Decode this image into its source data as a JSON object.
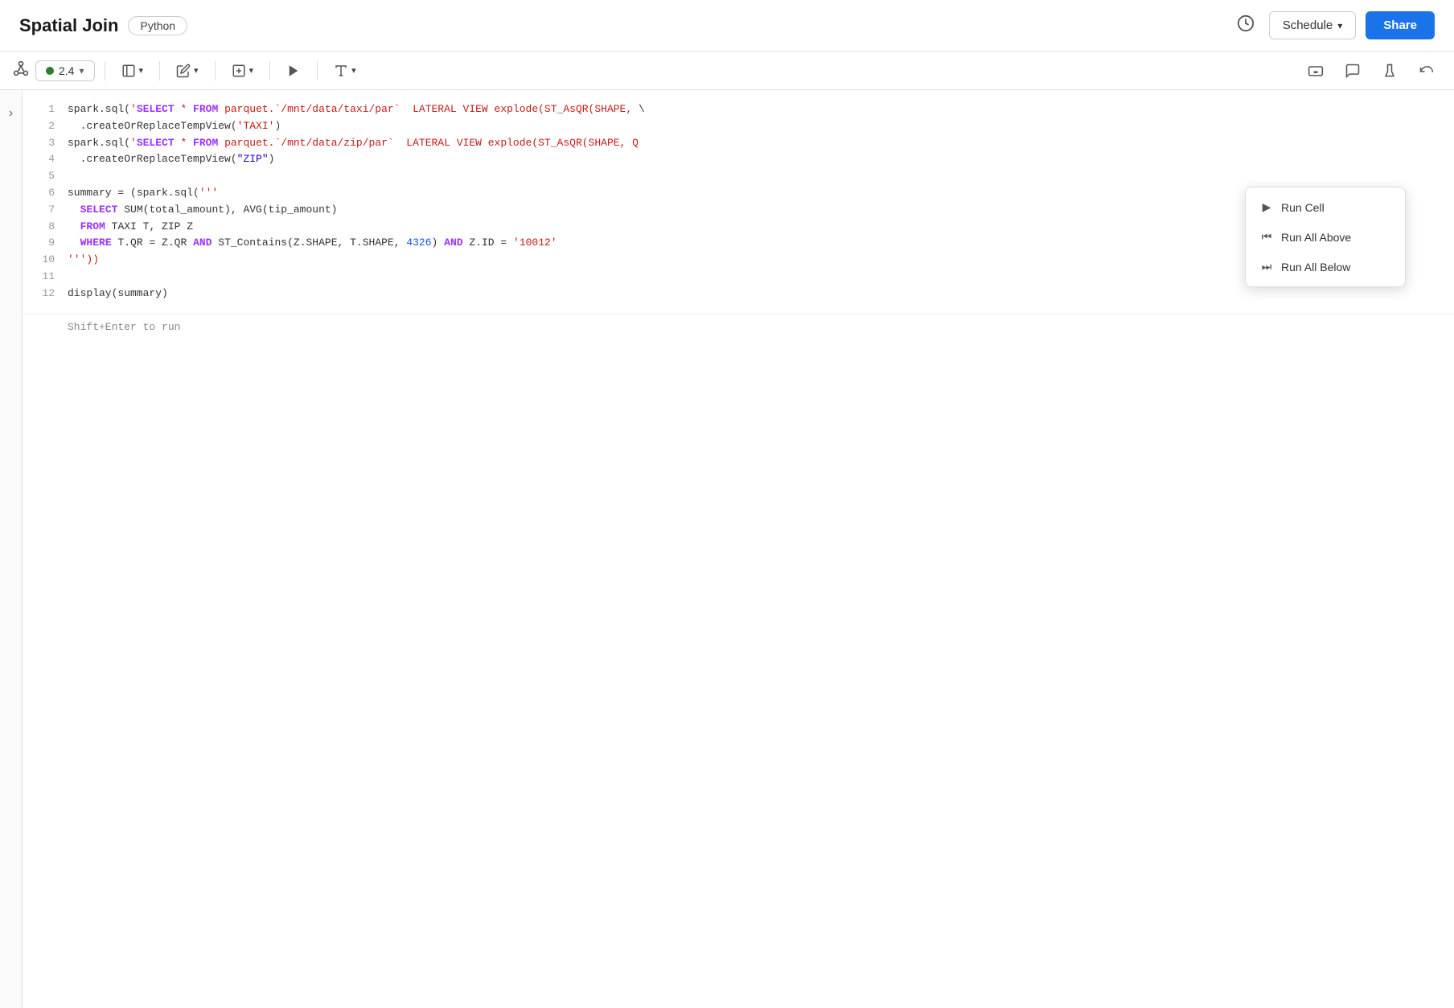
{
  "header": {
    "title": "Spatial Join",
    "language_badge": "Python",
    "schedule_label": "Schedule",
    "share_label": "Share"
  },
  "toolbar": {
    "cluster_version": "2.4",
    "buttons": {
      "notebook_menu": "≡",
      "edit": "✎",
      "insert": "⊞",
      "run": "▶",
      "run_dropdown": "▾",
      "keyboard": "⌨",
      "comment": "💬",
      "experiment": "⚗",
      "history": "↺"
    }
  },
  "sidebar": {
    "toggle_icon": "›"
  },
  "code_lines": [
    {
      "number": 1,
      "content": "spark.sql('SELECT * FROM parquet.`/mnt/data/taxi/par` LATERAL VIEW explode(ST_AsQR(SHAPE, \\"
    },
    {
      "number": 2,
      "content": ".createOrReplaceTempView('TAXI')"
    },
    {
      "number": 3,
      "content": "spark.sql('SELECT * FROM parquet.`/mnt/data/zip/par` LATERAL VIEW explode(ST_AsQR(SHAPE, Q"
    },
    {
      "number": 4,
      "content": ".createOrReplaceTempView(\"ZIP\")"
    },
    {
      "number": 5,
      "content": ""
    },
    {
      "number": 6,
      "content": "summary = (spark.sql('''"
    },
    {
      "number": 7,
      "content": "  SELECT SUM(total_amount), AVG(tip_amount)"
    },
    {
      "number": 8,
      "content": "  FROM TAXI T, ZIP Z"
    },
    {
      "number": 9,
      "content": "  WHERE T.QR = Z.QR AND ST_Contains(Z.SHAPE, T.SHAPE, 4326) AND Z.ID = '10012'"
    },
    {
      "number": 10,
      "content": "'''))"
    },
    {
      "number": 11,
      "content": ""
    },
    {
      "number": 12,
      "content": "display(summary)"
    }
  ],
  "hint": "Shift+Enter to run",
  "context_menu": {
    "items": [
      {
        "icon": "▶",
        "label": "Run Cell"
      },
      {
        "icon": "⏮",
        "label": "Run All Above"
      },
      {
        "icon": "⏭",
        "label": "Run All Below"
      }
    ]
  }
}
